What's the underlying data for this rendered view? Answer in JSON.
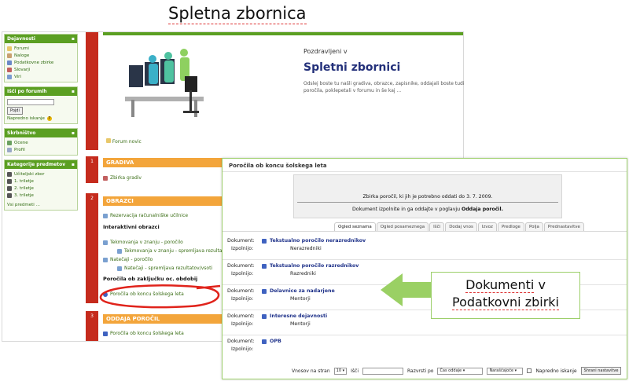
{
  "slide": {
    "title": "Spletna zbornica"
  },
  "left": {
    "dejavnosti": {
      "title": "Dejavnosti",
      "items": [
        "Forumi",
        "Naloge",
        "Podatkovne zbirke",
        "Slovarji",
        "Viri"
      ]
    },
    "search": {
      "title": "Išči po forumih",
      "button": "Pojdi",
      "advanced": "Napredno iskanje"
    },
    "admin": {
      "title": "Skrbništvo",
      "items": [
        "Ocene",
        "Profil"
      ]
    },
    "courses": {
      "title": "Kategorije predmetov",
      "items": [
        "Učiteljski zbor",
        "1. triletje",
        "2. triletje",
        "3. triletje"
      ],
      "all": "Vsi predmeti ..."
    }
  },
  "center": {
    "intro": {
      "hello": "Pozdravljeni v",
      "title": "Spletni zbornici",
      "desc": "Odslej boste tu našli gradiva, obrazce, zapisnike, oddajali boste tudi poročila, poklepetali v forumu in še kaj ...",
      "forum_news": "Forum novic"
    },
    "sections": [
      {
        "num": "1",
        "title": "GRADIVA",
        "items": [
          "Zbirka gradiv"
        ]
      },
      {
        "num": "2",
        "title": "OBRAZCI",
        "items": [
          "Rezervacija računalniške učilnice",
          "Interaktivni obrazci",
          "Tekmovanja v znanju - poročilo",
          "Tekmovanja v znanju - spremljava rezultatov",
          "Natečaji - poročilo",
          "Natečaji - spremljava rezultatov/vsoti",
          "Poročila ob zaključku oc. obdobij",
          "Poročila ob koncu šolskega leta"
        ]
      },
      {
        "num": "3",
        "title": "ODDAJA POROČIL",
        "items": [
          "Poročila ob koncu šolskega leta"
        ]
      }
    ]
  },
  "overlay": {
    "title": "Poročila ob koncu šolskega leta",
    "info_line1": "Zbirka poročil, ki jih je potrebno oddati do 3. 7. 2009.",
    "info_line2_prefix": "Dokument izpolnite in ga oddajte v poglavju ",
    "info_line2_bold": "Oddaja poročil.",
    "tabs": [
      "Ogled seznama",
      "Ogled posameznega",
      "Išči",
      "Dodaj vnos",
      "Izvoz",
      "Predloge",
      "Polja",
      "Prednastavitve"
    ],
    "doc_label": "Dokument:",
    "filler_label": "Izpolnijo:",
    "docs": [
      {
        "title": "Tekstualno poročilo nerazrednikov",
        "filler": "Nerazredniki"
      },
      {
        "title": "Tekstualno poročilo razrednikov",
        "filler": "Razredniki"
      },
      {
        "title": "Delavnice za nadarjene",
        "filler": "Mentorji"
      },
      {
        "title": "Interesne dejavnosti",
        "filler": "Mentorji"
      },
      {
        "title": "OPB",
        "filler": ""
      }
    ],
    "footer": {
      "per_page_label": "Vnosov na stran",
      "per_page_value": "10",
      "search_label": "Išči",
      "sort_label": "Razvrsti po",
      "sort_value": "Čas oddaje",
      "order_value": "Naraščajoče",
      "advanced_label": "Napredno iskanje",
      "save_button": "Shrani nastavitve"
    }
  },
  "callout": {
    "line1_a": "Dokumenti",
    "line1_b": " v",
    "line2": "Podatkovni zbirki"
  }
}
